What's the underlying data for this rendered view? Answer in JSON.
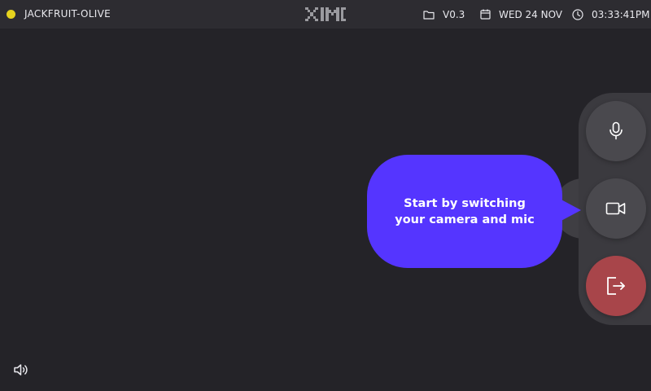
{
  "topbar": {
    "device_name": "JACKFRUIT-OLIVE",
    "status_color": "#e6d31e",
    "logo_icon": "ximi-logo",
    "version": "V0.3",
    "version_icon": "folder-icon",
    "date": "WED 24 NOV",
    "date_icon": "calendar-icon",
    "time": "03:33:41PM",
    "time_icon": "clock-icon"
  },
  "controls": {
    "mic_icon": "microphone-icon",
    "camera_icon": "video-camera-icon",
    "leave_icon": "exit-icon",
    "leave_color": "#a8454a"
  },
  "tooltip": {
    "line1": "Start by switching",
    "line2": "your camera and mic",
    "color": "#5535ff"
  },
  "footer": {
    "speaker_icon": "speaker-icon"
  }
}
